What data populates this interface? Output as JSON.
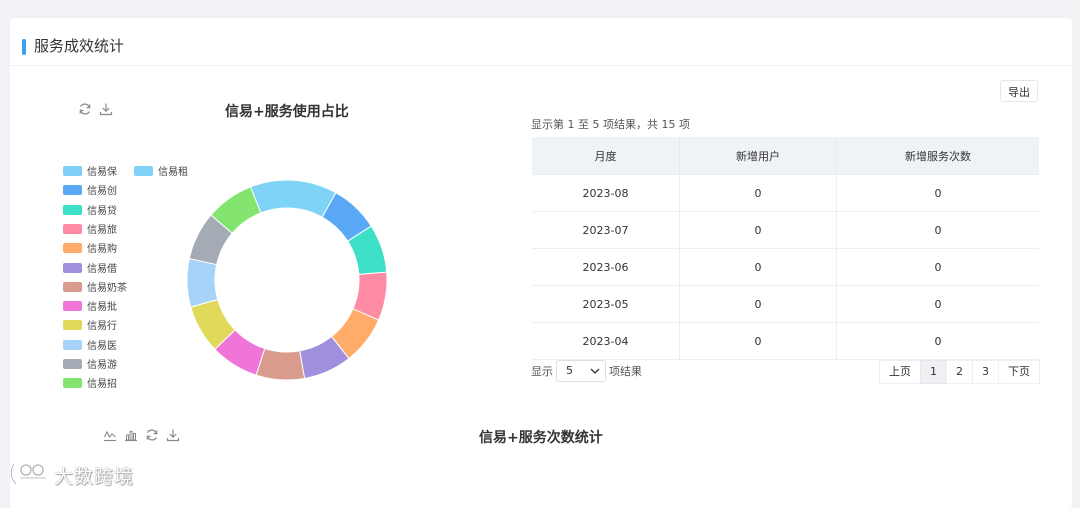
{
  "card": {
    "title": "服务成效统计"
  },
  "pie_section": {
    "title": "信易+服务使用占比",
    "toolbar_icons": [
      "refresh-icon",
      "download-icon"
    ]
  },
  "chart_data": {
    "type": "pie",
    "title": "信易+服务使用占比",
    "legend_position": "left",
    "categories": [
      "信易保",
      "信易租",
      "信易创",
      "信易贷",
      "信易旅",
      "信易购",
      "信易借",
      "信易奶茶",
      "信易批",
      "信易行",
      "信易医",
      "信易游",
      "信易招"
    ],
    "values": [
      0,
      9,
      5,
      5,
      5,
      5,
      5,
      5,
      5,
      5,
      5,
      5,
      5
    ],
    "colors": [
      "#7ecef5",
      "#7fd3f7",
      "#5aa8f5",
      "#3ddfc6",
      "#ff8aa4",
      "#ffac6b",
      "#a08fdc",
      "#d99b8c",
      "#ef76d8",
      "#e0d959",
      "#a8d3f8",
      "#a4abb4",
      "#83e56f"
    ]
  },
  "table_section": {
    "export_label": "导出",
    "info": "显示第 1 至 5 项结果，共 15 项",
    "columns": [
      "月度",
      "新增用户",
      "新增服务次数"
    ],
    "rows": [
      [
        "2023-08",
        "0",
        "0"
      ],
      [
        "2023-07",
        "0",
        "0"
      ],
      [
        "2023-06",
        "0",
        "0"
      ],
      [
        "2023-05",
        "0",
        "0"
      ],
      [
        "2023-04",
        "0",
        "0"
      ]
    ],
    "page_size_prefix": "显示",
    "page_size_value": "5",
    "page_size_suffix": "项结果",
    "pager": {
      "prev": "上页",
      "pages": [
        "1",
        "2",
        "3"
      ],
      "active": "1",
      "next": "下页"
    }
  },
  "count_section": {
    "title": "信易+服务次数统计",
    "toolbar_icons": [
      "line-chart-icon",
      "bar-chart-icon",
      "refresh-icon",
      "download-icon"
    ]
  },
  "watermark": {
    "text": "大数跨境"
  }
}
